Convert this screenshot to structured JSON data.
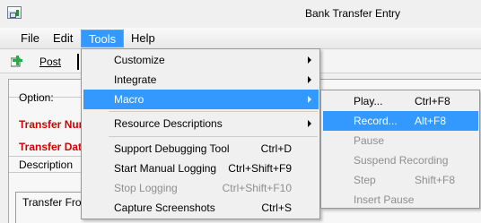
{
  "window": {
    "title": "Bank Transfer Entry"
  },
  "menubar": [
    "File",
    "Edit",
    "Tools",
    "Help"
  ],
  "toolbar": {
    "post_label": "Post"
  },
  "form": {
    "option_label": "Option:",
    "transfer_number_label": "Transfer Nur",
    "transfer_date_label": "Transfer Dat",
    "description_label": "Description",
    "transfer_from_label": "Transfer From"
  },
  "tools_menu": [
    {
      "label": "Customize",
      "submenu": true
    },
    {
      "label": "Integrate",
      "submenu": true
    },
    {
      "label": "Macro",
      "submenu": true,
      "highlighted": true
    },
    {
      "label": "Resource Descriptions",
      "submenu": true
    },
    {
      "label": "Support Debugging Tool",
      "shortcut": "Ctrl+D"
    },
    {
      "label": "Start Manual Logging",
      "shortcut": "Ctrl+Shift+F9"
    },
    {
      "label": "Stop Logging",
      "shortcut": "Ctrl+Shift+F10",
      "disabled": true
    },
    {
      "label": "Capture Screenshots",
      "shortcut": "Ctrl+S"
    }
  ],
  "macro_submenu": [
    {
      "label": "Play...",
      "shortcut": "Ctrl+F8"
    },
    {
      "label": "Record...",
      "shortcut": "Alt+F8",
      "highlighted": true
    },
    {
      "label": "Pause",
      "disabled": true
    },
    {
      "label": "Suspend Recording",
      "disabled": true
    },
    {
      "label": "Step",
      "shortcut": "Shift+F8",
      "disabled": true
    },
    {
      "label": "Insert Pause",
      "disabled": true
    }
  ]
}
